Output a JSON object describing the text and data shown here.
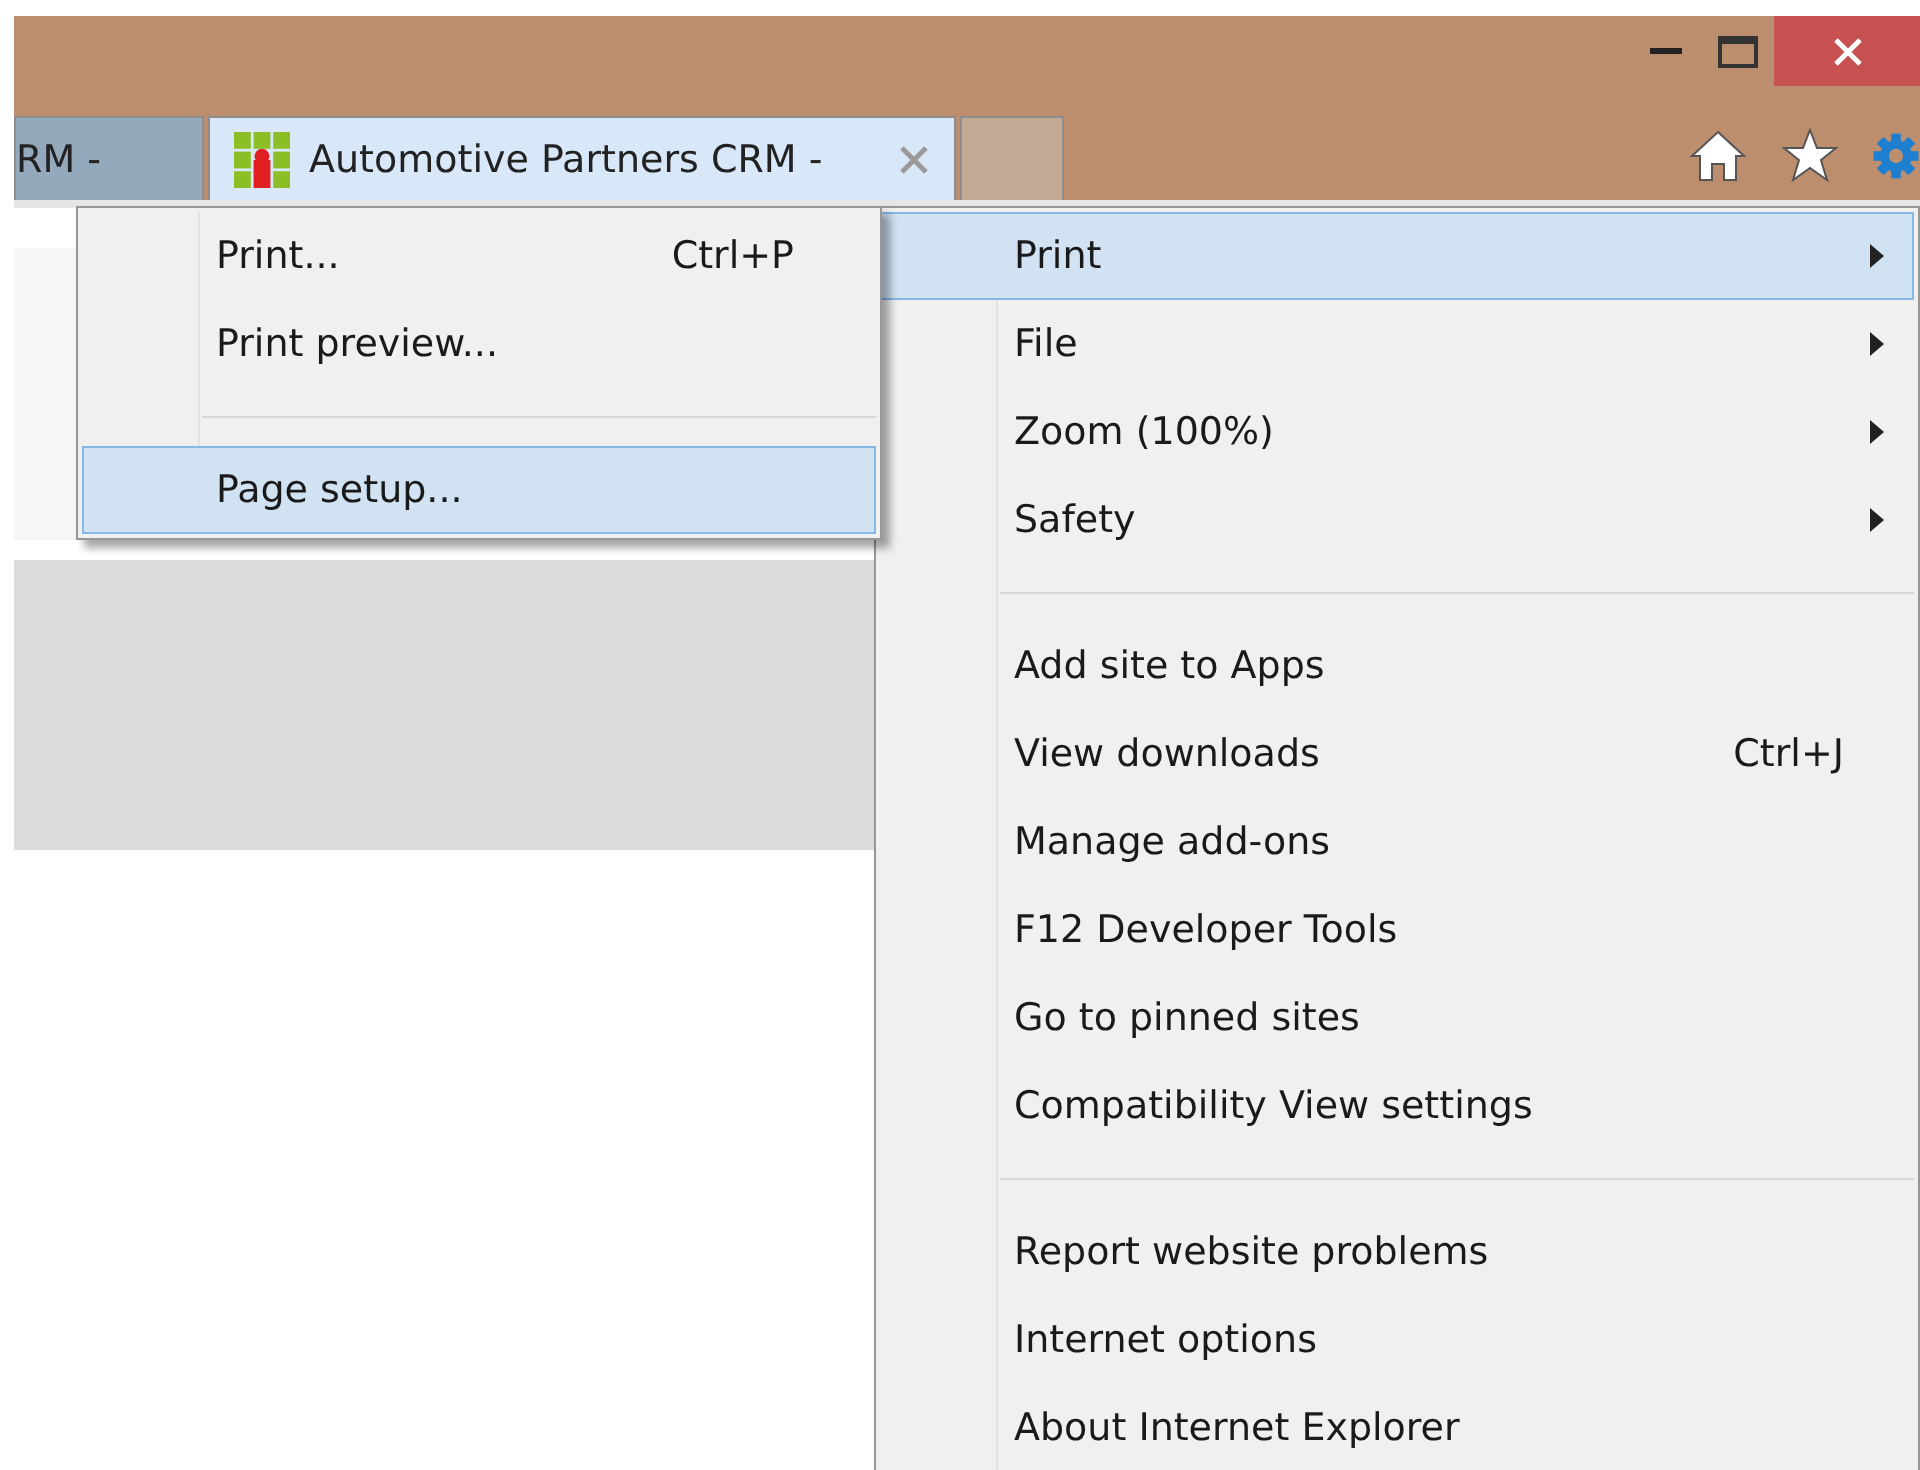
{
  "tabs": [
    {
      "label": "RM -",
      "selected": false
    },
    {
      "label": "Automotive Partners CRM -",
      "selected": true
    }
  ],
  "tools_menu": {
    "groups": [
      [
        {
          "label": "Print",
          "has_submenu": true,
          "selected": true
        },
        {
          "label": "File",
          "has_submenu": true,
          "selected": false
        },
        {
          "label": "Zoom (100%)",
          "has_submenu": true,
          "selected": false
        },
        {
          "label": "Safety",
          "has_submenu": true,
          "selected": false
        }
      ],
      [
        {
          "label": "Add site to Apps",
          "selected": false
        },
        {
          "label": "View downloads",
          "shortcut": "Ctrl+J",
          "selected": false
        },
        {
          "label": "Manage add-ons",
          "selected": false
        },
        {
          "label": "F12 Developer Tools",
          "selected": false
        },
        {
          "label": "Go to pinned sites",
          "selected": false
        },
        {
          "label": "Compatibility View settings",
          "selected": false
        }
      ],
      [
        {
          "label": "Report website problems",
          "selected": false
        },
        {
          "label": "Internet options",
          "selected": false
        },
        {
          "label": "About Internet Explorer",
          "selected": false
        }
      ]
    ]
  },
  "print_submenu": {
    "groups": [
      [
        {
          "label": "Print...",
          "shortcut": "Ctrl+P",
          "selected": false
        },
        {
          "label": "Print preview...",
          "selected": false
        }
      ],
      [
        {
          "label": "Page setup...",
          "selected": true
        }
      ]
    ]
  }
}
